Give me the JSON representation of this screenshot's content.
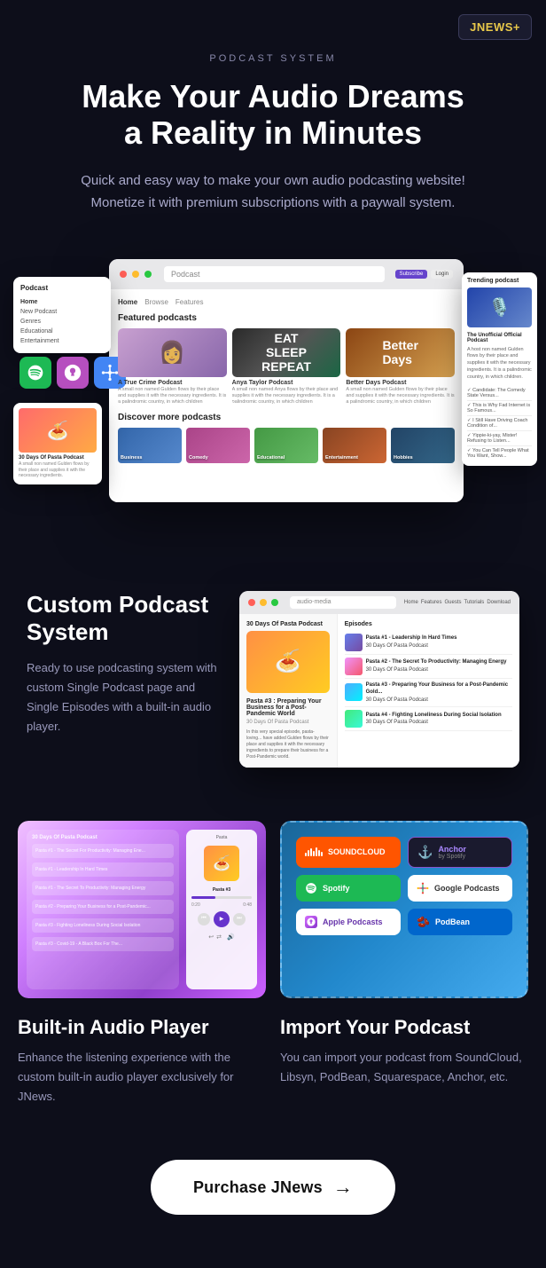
{
  "badge": {
    "text": "JNEWS",
    "plus": "+"
  },
  "hero": {
    "label": "PODCAST SYSTEM",
    "title_line1": "Make Your Audio Dreams",
    "title_line2": "a Reality in Minutes",
    "description": "Quick and easy way to make your own audio podcasting website! Monetize it with premium subscriptions with a paywall system."
  },
  "mockup": {
    "url": "Podcast",
    "nav": [
      "Home",
      "Browse",
      "Features",
      "Login"
    ],
    "featured_label": "Featured podcasts",
    "trending_label": "Trending podcast",
    "cards": [
      {
        "title": "A True Crime Podcast",
        "desc": "A small man named Gulden flows by their place..."
      },
      {
        "title": "Anya Taylor Podcast",
        "desc": "A small man named Anya flows by their place and supplies..."
      },
      {
        "title": "Better Days Podcast",
        "desc": "A small man named Gulden flows by their place..."
      }
    ],
    "discover_label": "Discover more podcasts",
    "categories": [
      "Business",
      "Comedy",
      "Educational",
      "Entertainment",
      "Hobbies"
    ],
    "trending_items": [
      "Candidate: The Comedy State Versus...",
      "This is Why Fad Internet is So Famous...",
      "I Still Have Driving Coach Condition of...",
      "Yippie-ki-yay, Mister! Refusing to Listen...",
      "You Can Tell People What You Want, Show..."
    ],
    "sidebar_items": [
      "Home",
      "New Podcast",
      "Genres",
      "Educational",
      "Entertainment"
    ]
  },
  "custom_podcast": {
    "title": "Custom Podcast System",
    "description": "Ready to use podcasting system with custom Single Podcast page and Single Episodes with a built-in audio player.",
    "audio_media_url": "audio-media",
    "episodes": [
      {
        "title": "Pasta #1 - Leadership In Hard Times",
        "thumb": "1"
      },
      {
        "title": "Pasta #2 - The Secret To Productivity: Managing Energy",
        "thumb": "2"
      },
      {
        "title": "Pasta #3 - Preparing Your Business for a Post-Pandemic...",
        "thumb": "3"
      },
      {
        "title": "Pasta #4 - Fighting Loneliness During Social Isolation",
        "thumb": "4"
      }
    ],
    "featured_episode": {
      "title": "Pasta #3 : Preparing Your Business for a Post-Pandemic World",
      "subtitle": "30 Days Of Pasta Podcast"
    }
  },
  "audio_player": {
    "title": "Built-in Audio Player",
    "description": "Enhance the listening experience with the custom built-in audio player exclusively for JNews."
  },
  "import_podcast": {
    "title": "Import Your Podcast",
    "description": "You can import your podcast from SoundCloud, Libsyn, PodBean, Squarespace, Anchor, etc.",
    "sources": [
      {
        "name": "SOUNDCLOUD",
        "class": "soundcloud"
      },
      {
        "name": "Anchor",
        "class": "anchor",
        "sub": "by Spotify"
      },
      {
        "name": "Spotify",
        "class": "spotify"
      },
      {
        "name": "Google Podcasts",
        "class": "google"
      },
      {
        "name": "Apple Podcasts",
        "class": "apple"
      },
      {
        "name": "PodBean",
        "class": "podbean"
      }
    ]
  },
  "purchase": {
    "label": "Purchase JNews",
    "arrow": "→"
  }
}
